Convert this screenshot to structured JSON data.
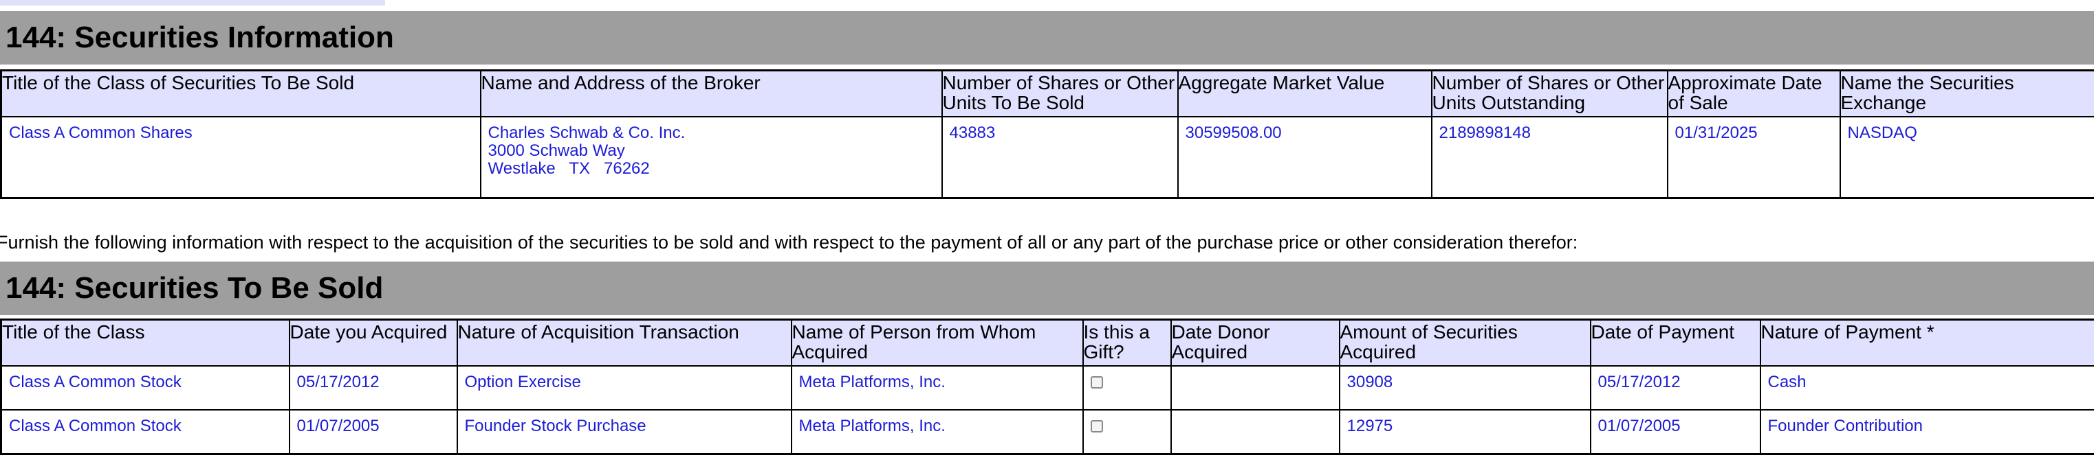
{
  "section1": {
    "title": "144: Securities Information",
    "headers": [
      "Title of the Class of Securities To Be Sold",
      "Name and Address of the Broker",
      "Number of Shares or Other Units To Be Sold",
      "Aggregate Market Value",
      "Number of Shares or Other Units Outstanding",
      "Approximate Date of Sale",
      "Name the Securities Exchange"
    ],
    "row": {
      "class_title": "Class A Common Shares",
      "broker_name": "Charles Schwab & Co. Inc.",
      "broker_street": "3000 Schwab Way",
      "broker_city_line": "Westlake   TX   76262",
      "shares_to_sell": "43883",
      "market_value": "30599508.00",
      "shares_outstanding": "2189898148",
      "sale_date": "01/31/2025",
      "exchange": "NASDAQ"
    }
  },
  "instruction": "Furnish the following information with respect to the acquisition of the securities to be sold and with respect to the payment of all or any part of the purchase price or other consideration therefor:",
  "section2": {
    "title": "144: Securities To Be Sold",
    "headers": [
      "Title of the Class",
      "Date you Acquired",
      "Nature of Acquisition Transaction",
      "Name of Person from Whom Acquired",
      "Is this a Gift?",
      "Date Donor Acquired",
      "Amount of Securities Acquired",
      "Date of Payment",
      "Nature of Payment *"
    ],
    "rows": [
      {
        "class_title": "Class A Common Stock",
        "date_acquired": "05/17/2012",
        "nature": "Option Exercise",
        "from_whom": "Meta Platforms, Inc.",
        "is_gift": false,
        "donor_date": "",
        "amount": "30908",
        "payment_date": "05/17/2012",
        "payment_nature": "Cash"
      },
      {
        "class_title": "Class A Common Stock",
        "date_acquired": "01/07/2005",
        "nature": "Founder Stock Purchase",
        "from_whom": "Meta Platforms, Inc.",
        "is_gift": false,
        "donor_date": "",
        "amount": "12975",
        "payment_date": "01/07/2005",
        "payment_nature": "Founder Contribution"
      }
    ]
  }
}
